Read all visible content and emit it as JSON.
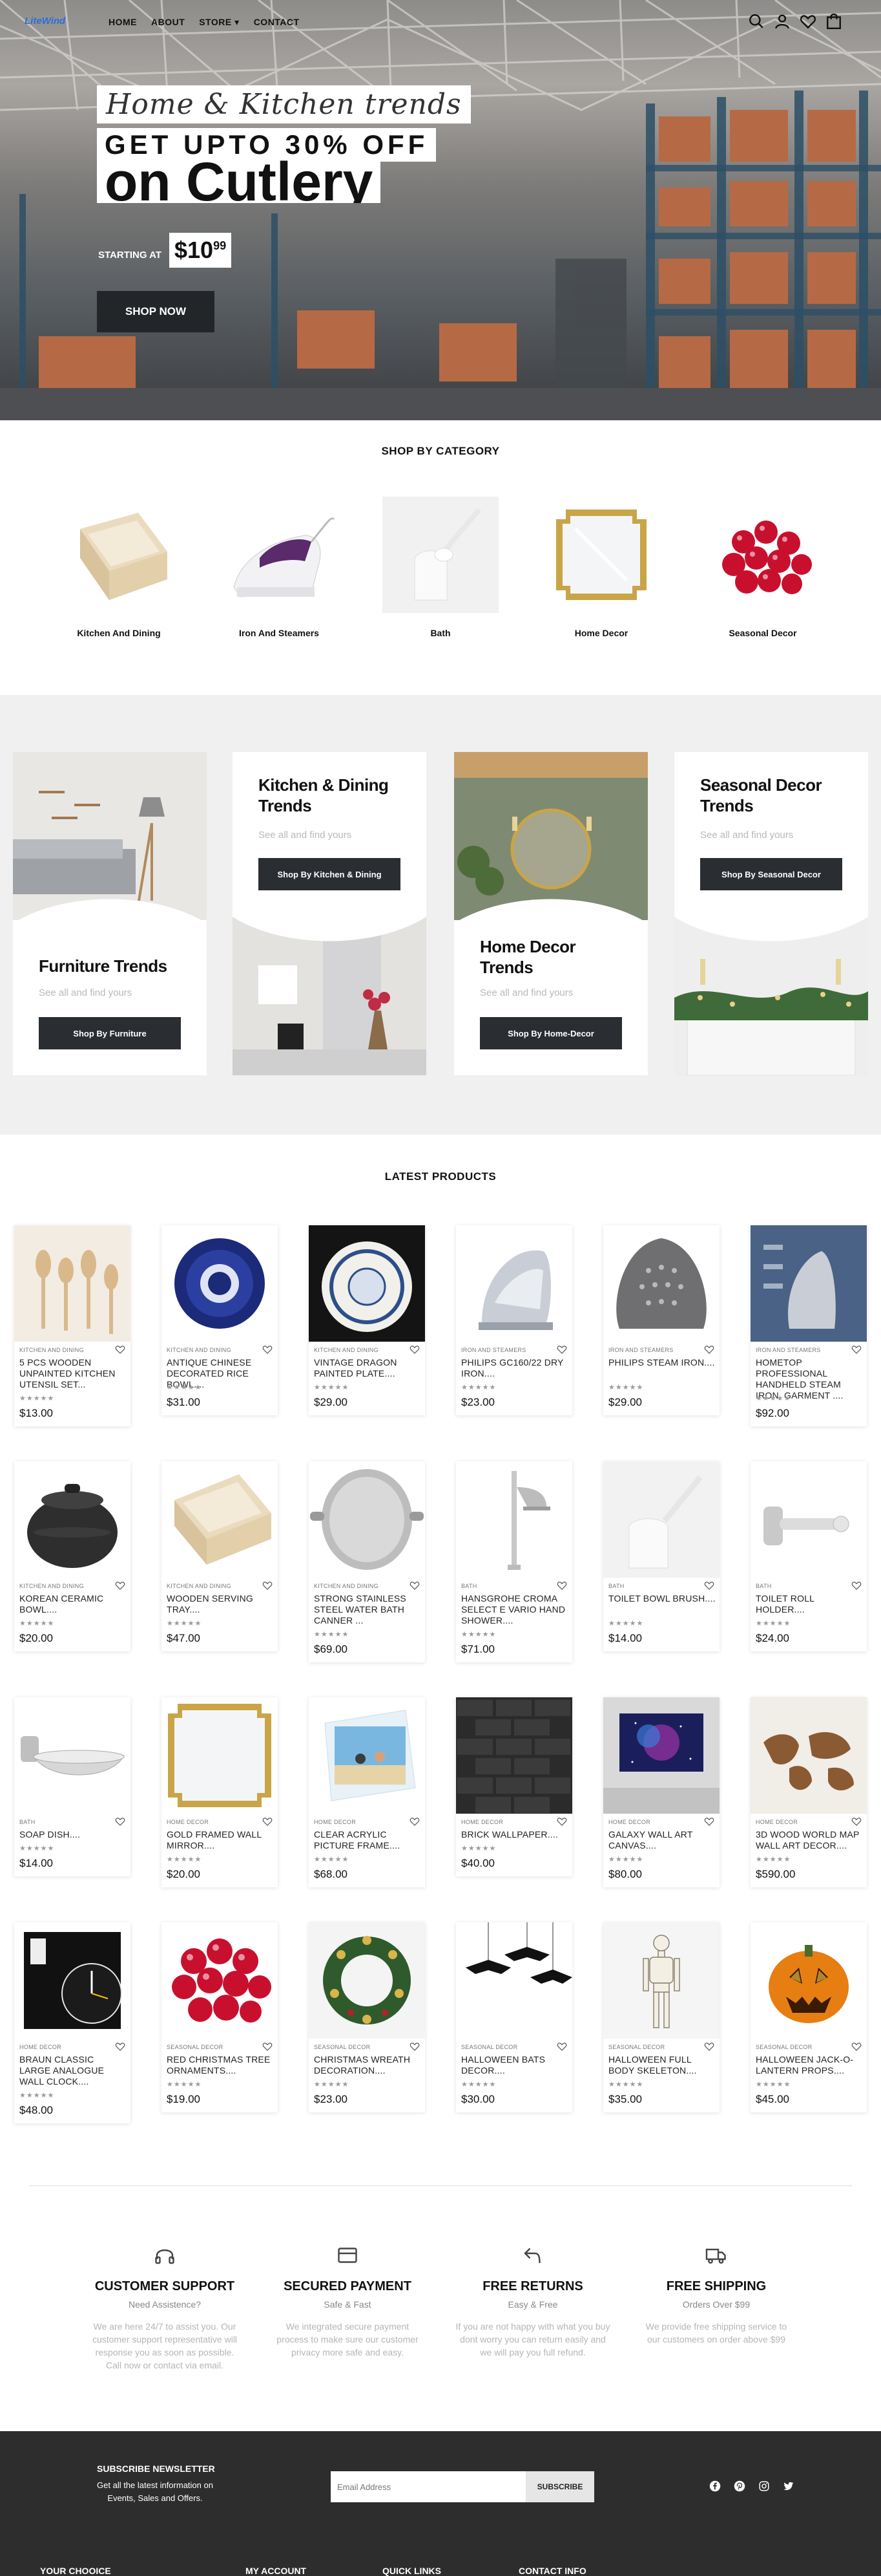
{
  "header": {
    "logo_text": "LiteWind",
    "nav": [
      "HOME",
      "ABOUT",
      "STORE",
      "CONTACT"
    ],
    "store_caret": "▾"
  },
  "hero": {
    "script_title": "Home & Kitchen trends",
    "line2": "GET UPTO 30% OFF",
    "line3": "on Cutlery",
    "starting_label": "STARTING AT",
    "price_main": "$10",
    "price_cents": "99",
    "cta": "SHOP NOW"
  },
  "categories": {
    "title": "SHOP BY CATEGORY",
    "items": [
      {
        "label": "Kitchen And Dining"
      },
      {
        "label": "Iron And Steamers"
      },
      {
        "label": "Bath"
      },
      {
        "label": "Home Decor"
      },
      {
        "label": "Seasonal Decor"
      }
    ]
  },
  "trends": [
    {
      "title": "Furniture Trends",
      "sub": "See all and find yours",
      "button": "Shop By Furniture"
    },
    {
      "title": "Kitchen & Dining Trends",
      "sub": "See all and find yours",
      "button": "Shop By Kitchen & Dining"
    },
    {
      "title": "Home Decor Trends",
      "sub": "See all and find yours",
      "button": "Shop By Home-Decor"
    },
    {
      "title": "Seasonal Decor Trends",
      "sub": "See all and find yours",
      "button": "Shop By Seasonal Decor"
    }
  ],
  "products": {
    "title": "LATEST PRODUCTS",
    "stars": "★★★★★",
    "items": [
      {
        "cat": "KITCHEN AND DINING",
        "name": "5 PCS WOODEN UNPAINTED KITCHEN UTENSIL SET...",
        "price": "$13.00"
      },
      {
        "cat": "KITCHEN AND DINING",
        "name": "ANTIQUE CHINESE DECORATED RICE BOWL....",
        "price": "$31.00"
      },
      {
        "cat": "KITCHEN AND DINING",
        "name": "VINTAGE DRAGON PAINTED PLATE....",
        "price": "$29.00"
      },
      {
        "cat": "IRON AND STEAMERS",
        "name": "PHILIPS GC160/22 DRY IRON....",
        "price": "$23.00"
      },
      {
        "cat": "IRON AND STEAMERS",
        "name": "PHILIPS STEAM IRON....",
        "price": "$29.00"
      },
      {
        "cat": "IRON AND STEAMERS",
        "name": "HOMETOP PROFESSIONAL HANDHELD STEAM IRON, GARMENT ....",
        "price": "$92.00"
      },
      {
        "cat": "KITCHEN AND DINING",
        "name": "KOREAN CERAMIC BOWL....",
        "price": "$20.00"
      },
      {
        "cat": "KITCHEN AND DINING",
        "name": "WOODEN SERVING TRAY....",
        "price": "$47.00"
      },
      {
        "cat": "KITCHEN AND DINING",
        "name": "STRONG STAINLESS STEEL WATER BATH CANNER ...",
        "price": "$69.00"
      },
      {
        "cat": "BATH",
        "name": "HANSGROHE CROMA SELECT E VARIO HAND SHOWER....",
        "price": "$71.00"
      },
      {
        "cat": "BATH",
        "name": "TOILET BOWL BRUSH....",
        "price": "$14.00"
      },
      {
        "cat": "BATH",
        "name": "TOILET ROLL HOLDER....",
        "price": "$24.00"
      },
      {
        "cat": "BATH",
        "name": "SOAP DISH....",
        "price": "$14.00"
      },
      {
        "cat": "HOME DECOR",
        "name": "GOLD FRAMED WALL MIRROR....",
        "price": "$20.00"
      },
      {
        "cat": "HOME DECOR",
        "name": "CLEAR ACRYLIC PICTURE FRAME....",
        "price": "$68.00"
      },
      {
        "cat": "HOME DECOR",
        "name": "BRICK WALLPAPER....",
        "price": "$40.00"
      },
      {
        "cat": "HOME DECOR",
        "name": "GALAXY WALL ART CANVAS....",
        "price": "$80.00"
      },
      {
        "cat": "HOME DECOR",
        "name": "3D WOOD WORLD MAP WALL ART DECOR....",
        "price": "$590.00"
      },
      {
        "cat": "HOME DECOR",
        "name": "BRAUN CLASSIC LARGE ANALOGUE WALL CLOCK....",
        "price": "$48.00"
      },
      {
        "cat": "SEASONAL DECOR",
        "name": "RED CHRISTMAS TREE ORNAMENTS....",
        "price": "$19.00"
      },
      {
        "cat": "SEASONAL DECOR",
        "name": "CHRISTMAS WREATH DECORATION....",
        "price": "$23.00"
      },
      {
        "cat": "SEASONAL DECOR",
        "name": "HALLOWEEN BATS DECOR....",
        "price": "$30.00"
      },
      {
        "cat": "SEASONAL DECOR",
        "name": "HALLOWEEN FULL BODY SKELETON....",
        "price": "$35.00"
      },
      {
        "cat": "SEASONAL DECOR",
        "name": "HALLOWEEN JACK-O-LANTERN PROPS....",
        "price": "$45.00"
      }
    ]
  },
  "features": [
    {
      "icon": "headphones-icon",
      "title": "CUSTOMER SUPPORT",
      "sub": "Need Assistence?",
      "text": "We are here 24/7 to assist you. Our customer support representative will response you as soon as possible. Call now or contact via email."
    },
    {
      "icon": "credit-card-icon",
      "title": "SECURED PAYMENT",
      "sub": "Safe & Fast",
      "text": "We integrated secure payment process to make sure our customer privacy more safe and easy."
    },
    {
      "icon": "return-arrow-icon",
      "title": "FREE RETURNS",
      "sub": "Easy & Free",
      "text": "If you are not happy with what you buy dont worry you can return easily and we will pay you full refund."
    },
    {
      "icon": "truck-icon",
      "title": "FREE SHIPPING",
      "sub": "Orders Over $99",
      "text": "We provide free shipping service to our customers on order above $99"
    }
  ],
  "footer": {
    "newsletter_title": "SUBSCRIBE NEWSLETTER",
    "newsletter_text": "Get all the latest information on Events, Sales and Offers.",
    "email_placeholder": "Email Address",
    "subscribe": "SUBSCRIBE",
    "columns": [
      "YOUR CHOOICE",
      "MY ACCOUNT",
      "QUICK LINKS",
      "CONTACT INFO"
    ]
  }
}
